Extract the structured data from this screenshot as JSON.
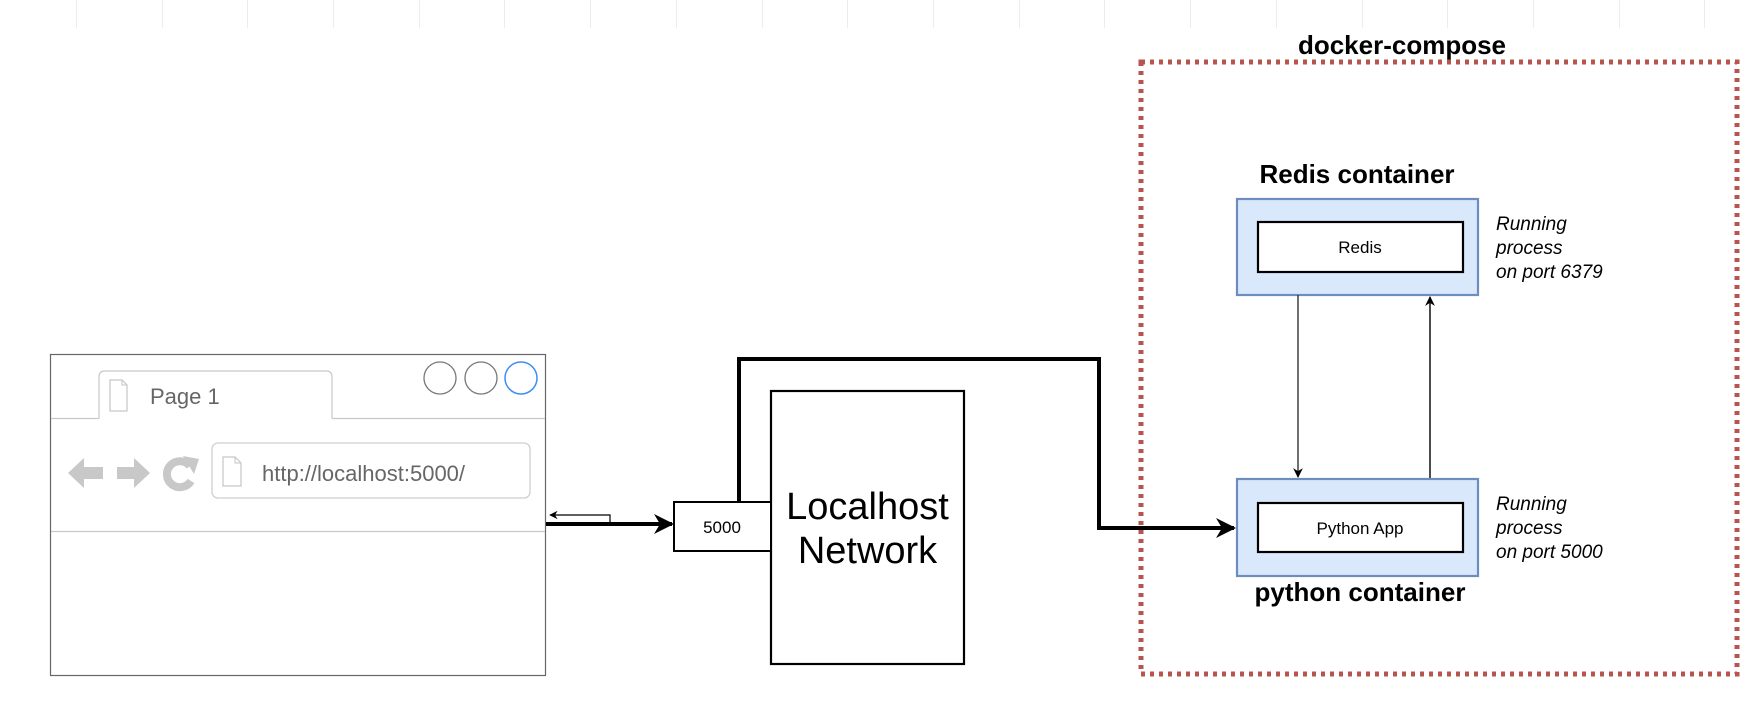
{
  "browser": {
    "tab_label": "Page 1",
    "url": "http://localhost:5000/",
    "window_controls": [
      "minimize-icon",
      "maximize-icon",
      "close-icon"
    ],
    "nav_icons": [
      "back-arrow-icon",
      "forward-arrow-icon",
      "reload-icon"
    ],
    "accent_color": "#3d8df5"
  },
  "network": {
    "port_label": "5000",
    "title_line1": "Localhost",
    "title_line2": "Network"
  },
  "compose": {
    "title": "docker-compose",
    "border_color": "#b85450"
  },
  "containers": {
    "redis": {
      "title": "Redis container",
      "process_label": "Redis",
      "note_line1": "Running",
      "note_line2": "process",
      "note_line3": "on  port 6379"
    },
    "python": {
      "title": "python container",
      "process_label": "Python App",
      "note_line1": "Running",
      "note_line2": "process",
      "note_line3": "on  port 5000"
    },
    "fill_color": "#dae8fc",
    "stroke_color": "#6c8ebf"
  }
}
